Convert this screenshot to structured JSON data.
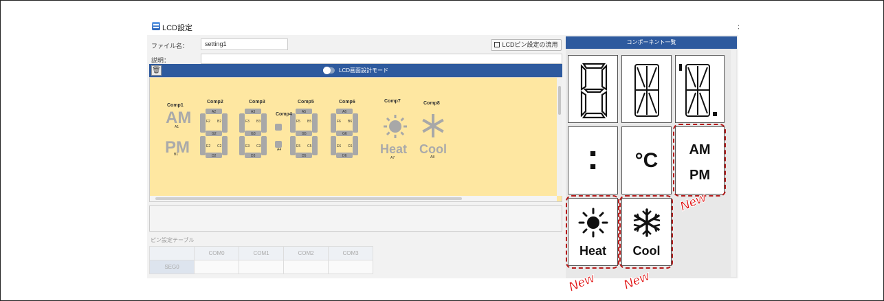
{
  "window": {
    "title": "LCD設定",
    "close": "×"
  },
  "form": {
    "filename_label": "ファイル名：",
    "filename_value": "setting1",
    "desc_label": "説明：",
    "desc_value": "",
    "pin_button": "LCDピン設定の流用"
  },
  "designer": {
    "mode_label": "LCD画面設計モード",
    "trash": "🗑"
  },
  "lcd": {
    "comps": [
      "Comp1",
      "Comp2",
      "Comp3",
      "Comp4",
      "Comp5",
      "Comp6",
      "Comp7",
      "Comp8"
    ],
    "am": "AM",
    "pm": "PM",
    "heat": "Heat",
    "cool": "Cool",
    "seg_labels": [
      "A1",
      "B1",
      "A2",
      "F2",
      "B2",
      "G2",
      "E2",
      "C2",
      "D2",
      "A3",
      "F3",
      "B3",
      "G3",
      "E3",
      "C3",
      "D3",
      "A4",
      "A5",
      "F5",
      "B5",
      "G5",
      "E5",
      "C5",
      "D5",
      "A6",
      "F6",
      "B6",
      "G6",
      "E6",
      "C6",
      "D6",
      "A7",
      "A8"
    ],
    "digit_value": "8"
  },
  "pin_table": {
    "label": "ピン設定テーブル",
    "columns": [
      "COM0",
      "COM1",
      "COM2",
      "COM3"
    ],
    "rows": [
      "SEG0"
    ]
  },
  "components": {
    "title": "コンポーネント一覧",
    "items": {
      "colon": ":",
      "celsius": "°C",
      "am": "AM",
      "pm": "PM",
      "heat": "Heat",
      "cool": "Cool"
    },
    "new_badge": "New"
  },
  "colors": {
    "accent": "#2e5a9e",
    "lcd_bg": "#fee7a1",
    "new": "#e01010"
  }
}
